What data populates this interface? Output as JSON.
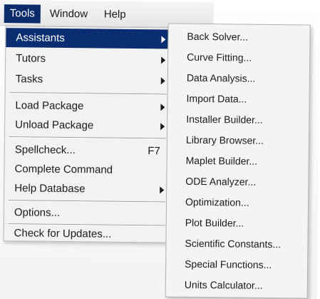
{
  "menubar": {
    "items": [
      {
        "label": "Tools",
        "active": true
      },
      {
        "label": "Window",
        "active": false
      },
      {
        "label": "Help",
        "active": false
      }
    ]
  },
  "tools_menu": {
    "items": [
      {
        "label": "Assistants",
        "has_submenu": true,
        "highlighted": true
      },
      {
        "label": "Tutors",
        "has_submenu": true
      },
      {
        "label": "Tasks",
        "has_submenu": true
      },
      {
        "label": "Load Package",
        "has_submenu": true
      },
      {
        "label": "Unload Package",
        "has_submenu": true
      },
      {
        "label": "Spellcheck...",
        "shortcut": "F7"
      },
      {
        "label": "Complete Command"
      },
      {
        "label": "Help Database",
        "has_submenu": true
      },
      {
        "label": "Options..."
      },
      {
        "label": "Check for Updates..."
      }
    ]
  },
  "assistants_submenu": {
    "items": [
      "Back Solver...",
      "Curve Fitting...",
      "Data Analysis...",
      "Import Data...",
      "Installer Builder...",
      "Library Browser...",
      "Maplet Builder...",
      "ODE Analyzer...",
      "Optimization...",
      "Plot Builder...",
      "Scientific Constants...",
      "Special Functions...",
      "Units Calculator..."
    ]
  }
}
